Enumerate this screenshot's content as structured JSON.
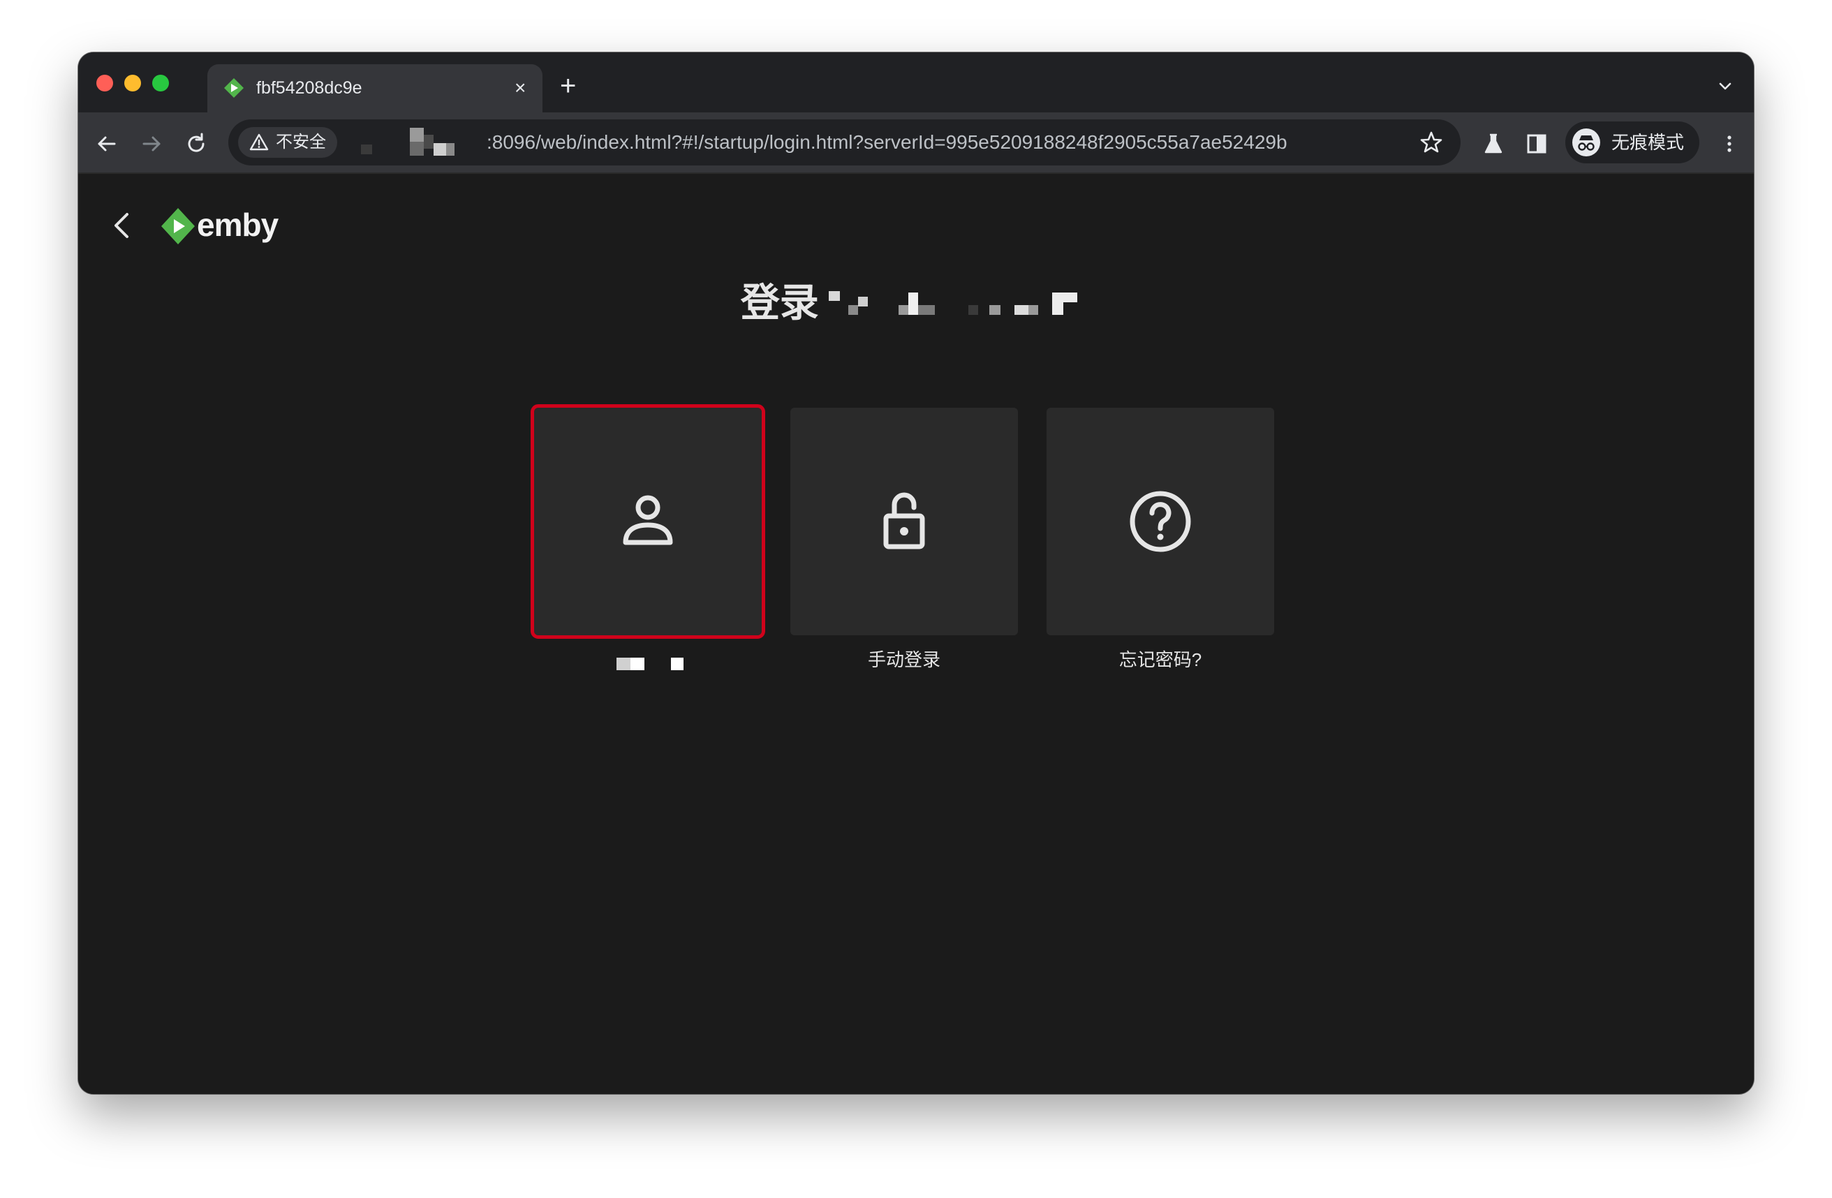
{
  "browser": {
    "tab": {
      "title": "fbf54208dc9e",
      "close_glyph": "×"
    },
    "new_tab_glyph": "+",
    "security_chip": "不安全",
    "url": ":8096/web/index.html?#!/startup/login.html?serverId=995e5209188248f2905c55a7ae52429b",
    "incognito_label": "无痕模式",
    "icons": [
      "back-icon",
      "forward-icon",
      "reload-icon",
      "warning-icon",
      "star-icon",
      "labs-icon",
      "side-panel-icon",
      "incognito-icon",
      "menu-icon",
      "chevron-down-icon"
    ]
  },
  "app": {
    "brand": "emby",
    "heading": "登录",
    "options": [
      {
        "label": "",
        "icon": "user-icon",
        "selected": true
      },
      {
        "label": "手动登录",
        "icon": "lock-open-icon",
        "selected": false
      },
      {
        "label": "忘记密码?",
        "icon": "help-circle-icon",
        "selected": false
      }
    ],
    "colors": {
      "accent": "#52b54b",
      "selection": "#d0021b",
      "background": "#1b1b1b",
      "card": "#2a2a2a"
    }
  }
}
